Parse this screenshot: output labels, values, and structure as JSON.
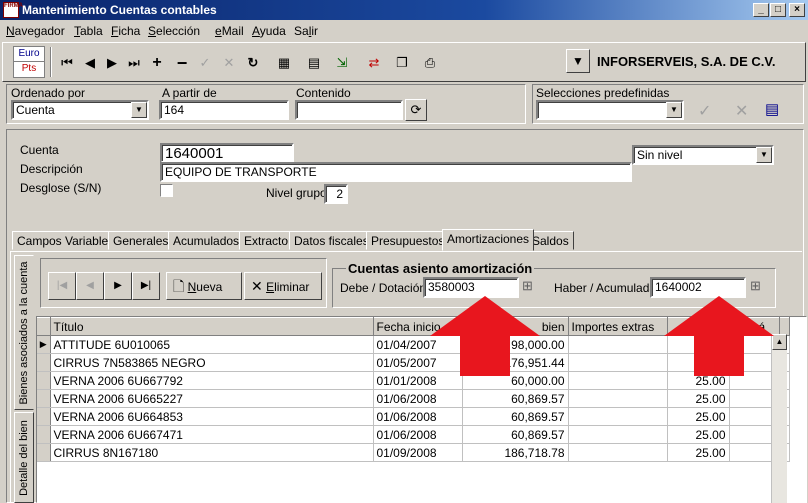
{
  "window": {
    "title": "Mantenimiento Cuentas contables",
    "app_icon_text": "FIRMA",
    "min": "_",
    "max": "□",
    "close": "×"
  },
  "menu": [
    {
      "pre": "",
      "u": "N",
      "post": "avegador"
    },
    {
      "pre": "",
      "u": "T",
      "post": "abla"
    },
    {
      "pre": "",
      "u": "F",
      "post": "icha"
    },
    {
      "pre": "",
      "u": "S",
      "post": "elección"
    },
    {
      "pre": "",
      "u": "e",
      "post": "Mail"
    },
    {
      "pre": "",
      "u": "A",
      "post": "yuda"
    },
    {
      "pre": "Sa",
      "u": "l",
      "post": "ir"
    }
  ],
  "toolbar": {
    "euro": "Euro",
    "pts": "Pts",
    "company": "INFORSERVEIS, S.A. DE C.V."
  },
  "filter": {
    "ordenado_label": "Ordenado por",
    "ordenado_value": "Cuenta",
    "apartir_label": "A partir de",
    "apartir_value": "164",
    "contenido_label": "Contenido",
    "contenido_value": "",
    "selecciones_label": "Selecciones predefinidas",
    "selecciones_value": ""
  },
  "account": {
    "cuenta_label": "Cuenta",
    "cuenta_value": "1640001",
    "descripcion_label": "Descripción",
    "descripcion_value": "EQUIPO DE TRANSPORTE",
    "desglose_label": "Desglose (S/N)",
    "nivel_label": "Nivel grupo",
    "nivel_value": "2",
    "nivel_select": "Sin nivel"
  },
  "tabs": [
    "Campos Variables",
    "Generales",
    "Acumulados",
    "Extracto",
    "Datos fiscales",
    "Presupuestos",
    "Amortizaciones",
    "Saldos"
  ],
  "active_tab": "Amortizaciones",
  "vtabs": [
    "Bienes asociados a la cuenta",
    "Detalle del bien"
  ],
  "actions": {
    "nueva_u": "N",
    "nueva_rest": "ueva",
    "eliminar_u": "E",
    "eliminar_rest": "liminar"
  },
  "asiento": {
    "title": "Cuentas asiento amortización",
    "debe_label": "Debe / Dotación",
    "debe_value": "3580003",
    "haber_label": "Haber / Acumulada",
    "haber_value": "1640002"
  },
  "grid": {
    "columns": [
      "Título",
      "Fecha inicio",
      "bien",
      "Importes extras",
      "",
      "os má"
    ],
    "rows": [
      {
        "titulo": "ATTITUDE 6U010065",
        "fecha": "01/04/2007",
        "bien": "98,000.00",
        "extras": "",
        "pct": ""
      },
      {
        "titulo": "CIRRUS 7N583865 NEGRO",
        "fecha": "01/05/2007",
        "bien": "176,951.44",
        "extras": "",
        "pct": ""
      },
      {
        "titulo": "VERNA 2006 6U667792",
        "fecha": "01/01/2008",
        "bien": "60,000.00",
        "extras": "",
        "pct": "25.00"
      },
      {
        "titulo": "VERNA 2006 6U665227",
        "fecha": "01/06/2008",
        "bien": "60,869.57",
        "extras": "",
        "pct": "25.00"
      },
      {
        "titulo": "VERNA 2006 6U664853",
        "fecha": "01/06/2008",
        "bien": "60,869.57",
        "extras": "",
        "pct": "25.00"
      },
      {
        "titulo": "VERNA 2006 6U667471",
        "fecha": "01/06/2008",
        "bien": "60,869.57",
        "extras": "",
        "pct": "25.00"
      },
      {
        "titulo": "CIRRUS 8N167180",
        "fecha": "01/09/2008",
        "bien": "186,718.78",
        "extras": "",
        "pct": "25.00"
      }
    ]
  },
  "colors": {
    "annotation_arrow": "#e8161e",
    "titlebar": "#0a246a"
  }
}
